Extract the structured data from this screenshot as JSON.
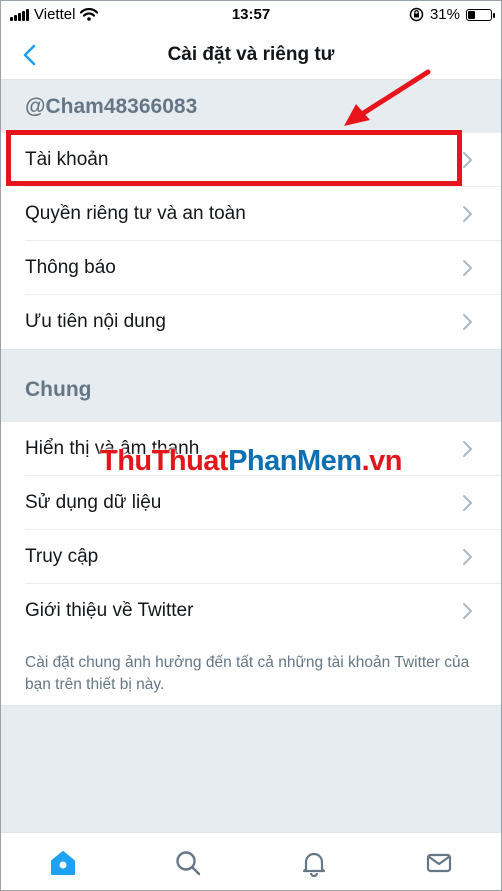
{
  "status_bar": {
    "carrier": "Viettel",
    "time": "13:57",
    "battery_text": "31%",
    "battery_level": 0.31
  },
  "nav": {
    "title": "Cài đặt và riêng tư",
    "back_icon": "chevron-left-icon"
  },
  "account_section": {
    "username": "@Cham48366083",
    "items": [
      {
        "label": "Tài khoản"
      },
      {
        "label": "Quyền riêng tư và an toàn"
      },
      {
        "label": "Thông báo"
      },
      {
        "label": "Ưu tiên nội dung"
      }
    ]
  },
  "general_section": {
    "title": "Chung",
    "items": [
      {
        "label": "Hiển thị và âm thanh"
      },
      {
        "label": "Sử dụng dữ liệu"
      },
      {
        "label": "Truy cập"
      },
      {
        "label": "Giới thiệu về Twitter"
      }
    ],
    "footnote": "Cài đặt chung ảnh hưởng đến tất cả những tài khoản Twitter của bạn trên thiết bị này."
  },
  "watermark": {
    "part1": "ThuThuat",
    "part2": "PhanMem",
    "part3": ".vn"
  },
  "tab_bar": {
    "tabs": [
      "home-icon",
      "search-icon",
      "notifications-bell-icon",
      "messages-mail-icon"
    ],
    "active_color": "#1da1f2",
    "inactive_color": "#657786"
  },
  "colors": {
    "accent": "#1da1f2",
    "annotation_red": "#e8141c",
    "background": "#e6ecf0"
  }
}
